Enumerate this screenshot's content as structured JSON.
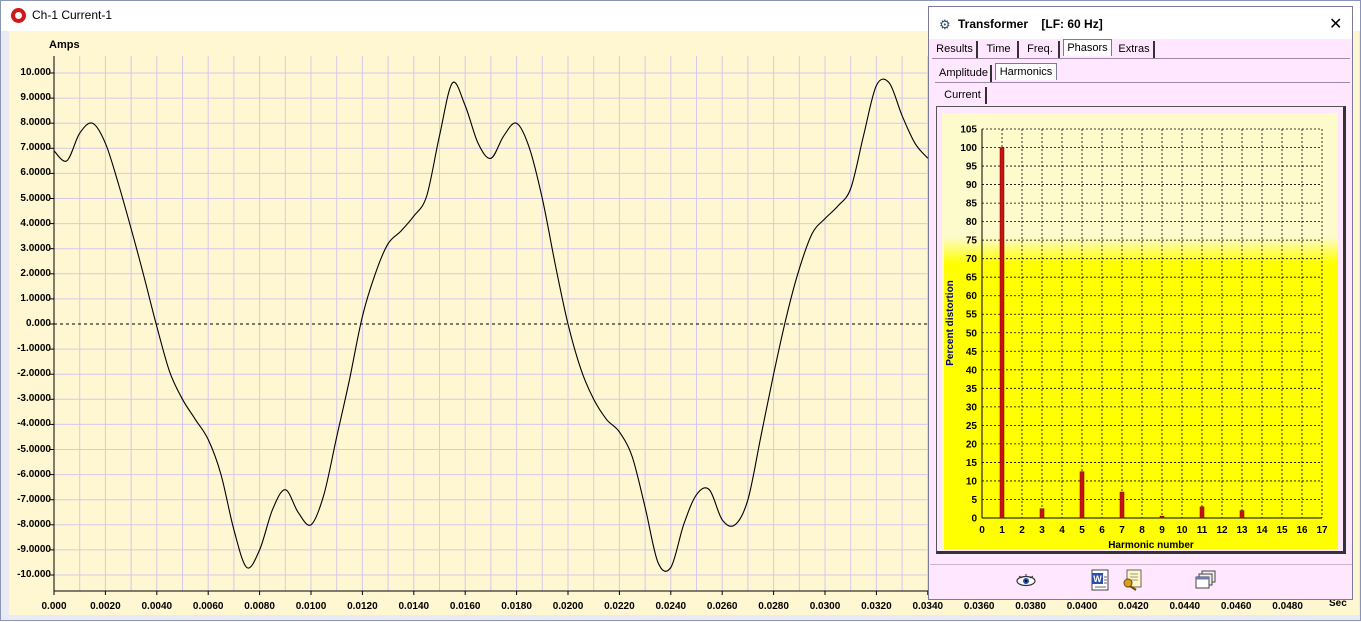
{
  "window": {
    "title": "Ch-1 Current-1"
  },
  "chart_data": {
    "type": "line",
    "ylabel": "Amps",
    "xlabel": "Sec",
    "ylim": [
      -11,
      11
    ],
    "xlim": [
      0,
      0.05
    ],
    "y_ticks": [
      "10.000",
      "9.0000",
      "8.0000",
      "7.0000",
      "6.0000",
      "5.0000",
      "4.0000",
      "3.0000",
      "2.0000",
      "1.0000",
      "0.000",
      "-1.0000",
      "-2.0000",
      "-3.0000",
      "-4.0000",
      "-5.0000",
      "-6.0000",
      "-7.0000",
      "-8.0000",
      "-9.0000",
      "-10.000"
    ],
    "x_ticks": [
      "0.000",
      "0.0020",
      "0.0040",
      "0.0060",
      "0.0080",
      "0.0100",
      "0.0120",
      "0.0140",
      "0.0160",
      "0.0180",
      "0.0200",
      "0.0220",
      "0.0240",
      "0.0260",
      "0.0280",
      "0.0300",
      "0.0320",
      "0.0340",
      "0.0360",
      "0.0380",
      "0.0400",
      "0.0420",
      "0.0440",
      "0.0460",
      "0.0480"
    ],
    "grid": true,
    "series": [
      {
        "values": {
          "x": [
            0,
            0.0005,
            0.001,
            0.0015,
            0.002,
            0.0025,
            0.003,
            0.0035,
            0.004,
            0.0045,
            0.005,
            0.0055,
            0.006,
            0.0065,
            0.007,
            0.0075,
            0.008,
            0.0085,
            0.009,
            0.0095,
            0.01,
            0.0105,
            0.011,
            0.0115,
            0.012,
            0.0125,
            0.013,
            0.0135,
            0.014,
            0.0145,
            0.015,
            0.0155,
            0.016,
            0.0165,
            0.017,
            0.0175,
            0.018,
            0.0185,
            0.019,
            0.0195,
            0.02,
            0.0205,
            0.021,
            0.0215,
            0.022,
            0.0225,
            0.023,
            0.0235,
            0.024,
            0.0245,
            0.025,
            0.0255,
            0.026,
            0.0265,
            0.027,
            0.0275,
            0.028,
            0.0285,
            0.029,
            0.0295,
            0.03,
            0.0305,
            0.031,
            0.0315,
            0.032,
            0.0325,
            0.033,
            0.0335,
            0.034
          ],
          "y": [
            6.9,
            6.5,
            7.6,
            8.0,
            7.2,
            5.6,
            3.8,
            1.9,
            -0.1,
            -1.9,
            -3.0,
            -3.8,
            -4.6,
            -6.0,
            -8.2,
            -9.7,
            -9.0,
            -7.4,
            -6.6,
            -7.5,
            -8.0,
            -6.8,
            -4.5,
            -2.2,
            0.3,
            2.0,
            3.2,
            3.7,
            4.3,
            5.1,
            7.5,
            9.6,
            8.7,
            7.2,
            6.6,
            7.5,
            8.0,
            7.0,
            5.0,
            2.4,
            0.0,
            -1.8,
            -3.0,
            -3.8,
            -4.3,
            -5.3,
            -7.3,
            -9.5,
            -9.7,
            -8.0,
            -6.8,
            -6.6,
            -7.8,
            -8.0,
            -7.0,
            -4.5,
            -2.0,
            0.3,
            2.2,
            3.6,
            4.2,
            4.7,
            5.4,
            7.5,
            9.5,
            9.6,
            8.3,
            7.2,
            6.6
          ]
        }
      }
    ]
  },
  "dialog": {
    "title": "Transformer",
    "subtitle": "[LF: 60 Hz]",
    "close_glyph": "✕",
    "tabs": [
      "Results",
      "Time",
      "Freq.",
      "Phasors",
      "Extras"
    ],
    "active_tab": "Phasors",
    "subtabs": [
      "Amplitude",
      "Harmonics"
    ],
    "active_subtab": "Harmonics",
    "subsubtabs": [
      "Current"
    ],
    "harmonics_chart": {
      "type": "bar",
      "xlabel": "Harmonic number",
      "ylabel": "Percent distortion",
      "ylim": [
        0,
        105
      ],
      "xlim": [
        0,
        17
      ],
      "y_ticks": [
        "0",
        "5",
        "10",
        "15",
        "20",
        "25",
        "30",
        "35",
        "40",
        "45",
        "50",
        "55",
        "60",
        "65",
        "70",
        "75",
        "80",
        "85",
        "90",
        "95",
        "100",
        "105"
      ],
      "x_ticks": [
        "0",
        "1",
        "2",
        "3",
        "4",
        "5",
        "6",
        "7",
        "8",
        "9",
        "10",
        "11",
        "12",
        "13",
        "14",
        "15",
        "16",
        "17"
      ],
      "grid": true,
      "bars": {
        "x": [
          1,
          3,
          5,
          7,
          9,
          11,
          13
        ],
        "values": [
          100,
          2.5,
          12.5,
          7,
          0.5,
          3,
          2
        ]
      },
      "bar_color": "#cc1111",
      "background_gradient": [
        "#fdfacc",
        "#ffff00"
      ]
    },
    "toolbar_icons": [
      "eye-icon",
      "word-document-icon",
      "settings-key-icon",
      "copy-windows-icon"
    ]
  }
}
